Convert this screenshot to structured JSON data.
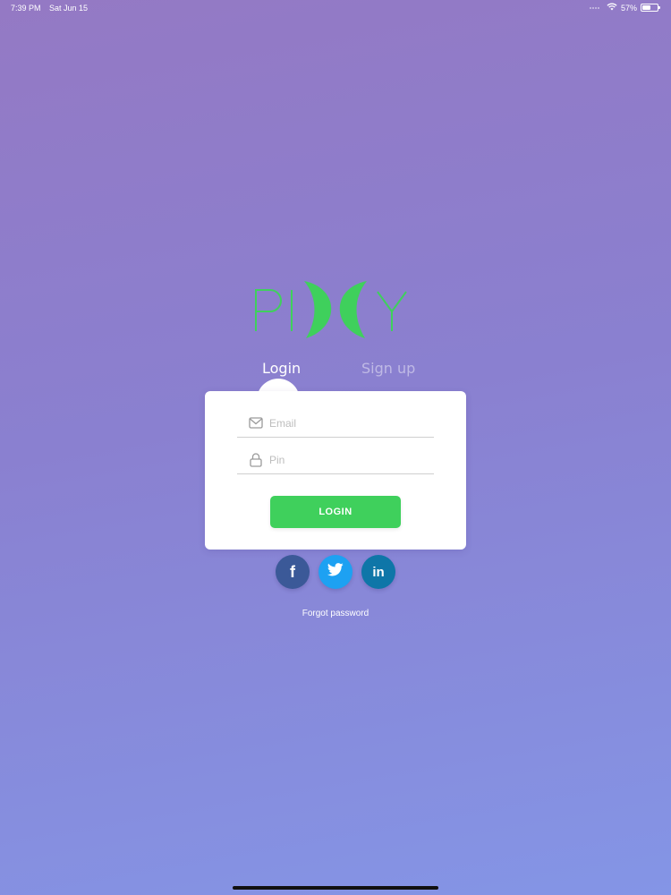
{
  "status_bar": {
    "time": "7:39 PM",
    "date": "Sat Jun 15",
    "battery_percent": "57%",
    "battery_level": 0.57,
    "icons": [
      "wifi-icon",
      "battery-icon"
    ]
  },
  "logo": {
    "brand": "PIXY",
    "colors": {
      "primary": "#3fd05c"
    }
  },
  "tabs": [
    {
      "label": "Login",
      "active": true
    },
    {
      "label": "Sign up",
      "active": false
    }
  ],
  "form": {
    "email": {
      "placeholder": "Email",
      "value": "",
      "icon": "mail-icon"
    },
    "pin": {
      "placeholder": "Pin",
      "value": "",
      "icon": "lock-icon"
    },
    "login_label": "LOGIN"
  },
  "social": [
    {
      "name": "facebook",
      "label": "f",
      "color": "#3b5998"
    },
    {
      "name": "twitter",
      "icon": "twitter-bird-icon",
      "color": "#1da1f2"
    },
    {
      "name": "linkedin",
      "label": "in",
      "color": "#0e76a8"
    }
  ],
  "forgot_label": "Forgot password",
  "colors": {
    "accent": "#3fd05c",
    "background_top": "#9479c4",
    "background_bottom": "#8495e6"
  }
}
